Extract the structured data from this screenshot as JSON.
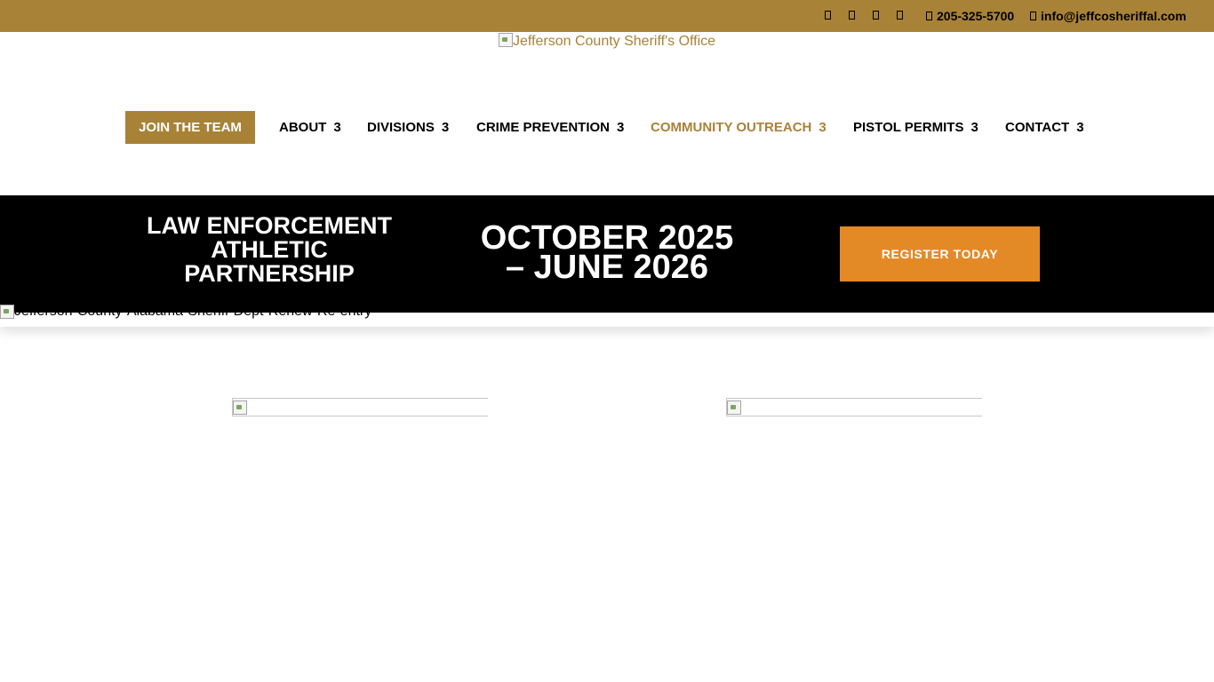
{
  "topbar": {
    "social_icons": [
      "facebook-icon",
      "twitter-icon",
      "instagram-icon",
      "youtube-icon"
    ],
    "phone_icon": "phone-icon",
    "phone": "205-325-5700",
    "email_icon": "envelope-icon",
    "email": "info@jeffcosheriffal.com"
  },
  "logo": {
    "alt": "Jefferson County Sheriff's Office"
  },
  "nav": {
    "join_label": "JOIN THE TEAM",
    "items": [
      {
        "label": "ABOUT",
        "chevron": "3"
      },
      {
        "label": "DIVISIONS",
        "chevron": "3"
      },
      {
        "label": "CRIME PREVENTION",
        "chevron": "3"
      },
      {
        "label": "COMMUNITY OUTREACH",
        "chevron": "3"
      },
      {
        "label": "PISTOL PERMITS",
        "chevron": "3"
      },
      {
        "label": "CONTACT",
        "chevron": "3"
      }
    ]
  },
  "banner": {
    "program_line1": "LAW ENFORCEMENT",
    "program_line2": "ATHLETIC",
    "program_line3": "PARTNERSHIP",
    "date_line1": "OCTOBER 2025",
    "date_line2": "– JUNE 2026",
    "register_label": "REGISTER TODAY"
  },
  "hero": {
    "alt": "Jefferson-County-Alabama-Sheriff-Dept-Renew-Re-entry"
  },
  "colors": {
    "brand_gold": "#a88237",
    "accent_orange": "#e38a27",
    "banner_bg": "#000000"
  }
}
